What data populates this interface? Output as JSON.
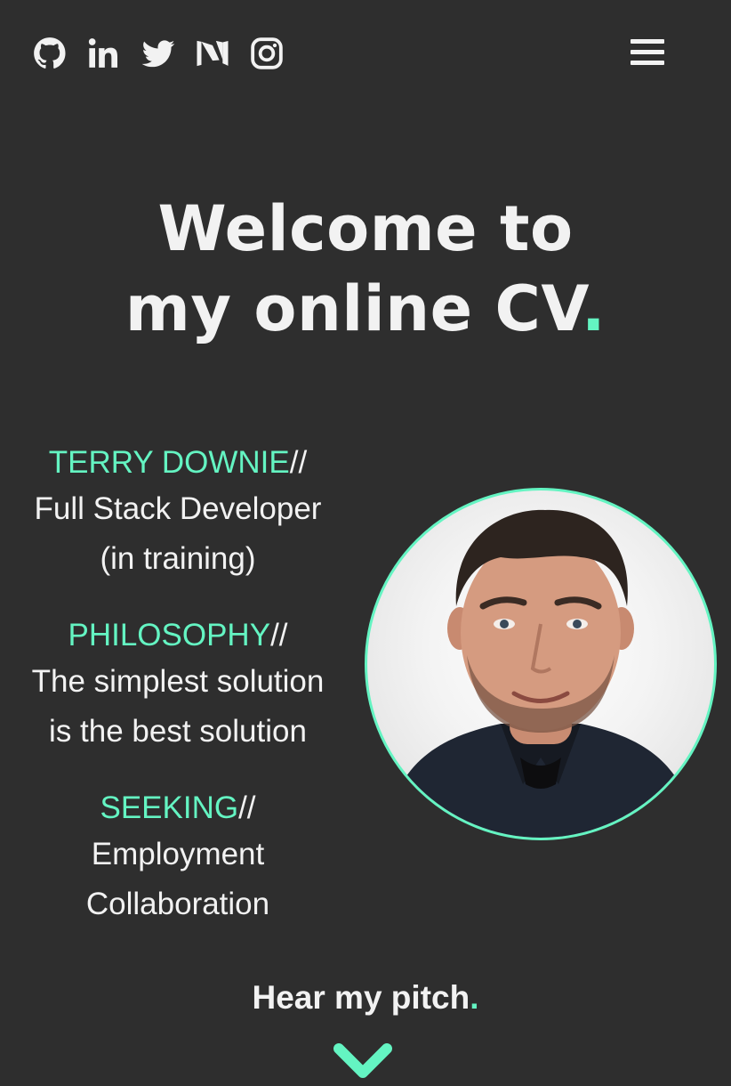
{
  "social": {
    "icons": [
      "github-icon",
      "linkedin-icon",
      "twitter-icon",
      "medium-icon",
      "instagram-icon"
    ]
  },
  "headline": {
    "line1": "Welcome to",
    "line2": "my online CV",
    "dot": "."
  },
  "profile": {
    "name_label": "TERRY DOWNIE",
    "name_sep": "//",
    "role_line1": "Full Stack Developer",
    "role_line2": "(in training)",
    "philosophy_label": "PHILOSOPHY",
    "philosophy_sep": "//",
    "philosophy_line1": "The simplest solution",
    "philosophy_line2": "is the best solution",
    "seeking_label": "SEEKING",
    "seeking_sep": "//",
    "seeking_line1": "Employment",
    "seeking_line2": "Collaboration"
  },
  "pitch": {
    "text": "Hear my pitch",
    "dot": "."
  },
  "colors": {
    "background": "#2e2e2e",
    "accent": "#64f4c2",
    "text": "#f2f2f2"
  }
}
